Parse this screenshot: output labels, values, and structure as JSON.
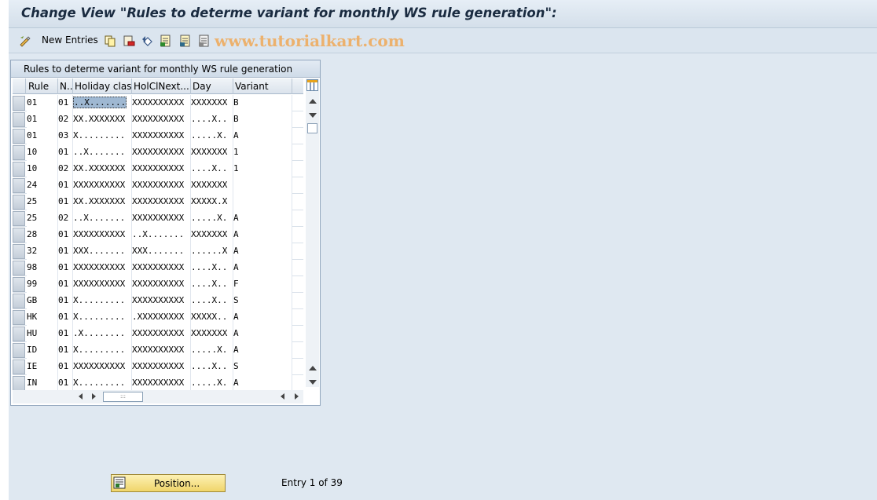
{
  "window": {
    "title": "Change View \"Rules to determe variant for monthly WS rule generation\":"
  },
  "toolbar": {
    "new_entries_label": "New Entries",
    "icons": [
      "display-change-icon",
      "copy-icon",
      "delete-icon",
      "undo-icon",
      "select-all-icon",
      "select-block-icon",
      "deselect-all-icon"
    ]
  },
  "watermark": "www.tutorialkart.com",
  "table": {
    "title": "Rules to determe variant for monthly WS rule generation",
    "columns": [
      "Rule",
      "N..",
      "Holiday class",
      "HolClNext...",
      "Day",
      "Variant"
    ],
    "rows": [
      [
        "01",
        "01",
        "..X.......",
        "XXXXXXXXXX",
        "XXXXXXX",
        "B"
      ],
      [
        "01",
        "02",
        "XX.XXXXXXX",
        "XXXXXXXXXX",
        "....X..",
        "B"
      ],
      [
        "01",
        "03",
        "X.........",
        "XXXXXXXXXX",
        ".....X.",
        "A"
      ],
      [
        "10",
        "01",
        "..X.......",
        "XXXXXXXXXX",
        "XXXXXXX",
        "1"
      ],
      [
        "10",
        "02",
        "XX.XXXXXXX",
        "XXXXXXXXXX",
        "....X..",
        "1"
      ],
      [
        "24",
        "01",
        "XXXXXXXXXX",
        "XXXXXXXXXX",
        "XXXXXXX",
        ""
      ],
      [
        "25",
        "01",
        "XX.XXXXXXX",
        "XXXXXXXXXX",
        "XXXXX.X",
        ""
      ],
      [
        "25",
        "02",
        "..X.......",
        "XXXXXXXXXX",
        ".....X.",
        "A"
      ],
      [
        "28",
        "01",
        "XXXXXXXXXX",
        "..X.......",
        "XXXXXXX",
        "A"
      ],
      [
        "32",
        "01",
        "XXX.......",
        "XXX.......",
        "......X",
        "A"
      ],
      [
        "98",
        "01",
        "XXXXXXXXXX",
        "XXXXXXXXXX",
        "....X..",
        "A"
      ],
      [
        "99",
        "01",
        "XXXXXXXXXX",
        "XXXXXXXXXX",
        "....X..",
        "F"
      ],
      [
        "GB",
        "01",
        "X.........",
        "XXXXXXXXXX",
        "....X..",
        "S"
      ],
      [
        "HK",
        "01",
        "X.........",
        ".XXXXXXXXX",
        "XXXXX..",
        "A"
      ],
      [
        "HU",
        "01",
        ".X........",
        "XXXXXXXXXX",
        "XXXXXXX",
        "A"
      ],
      [
        "ID",
        "01",
        "X.........",
        "XXXXXXXXXX",
        ".....X.",
        "A"
      ],
      [
        "IE",
        "01",
        "XXXXXXXXXX",
        "XXXXXXXXXX",
        "....X..",
        "S"
      ],
      [
        "IN",
        "01",
        "X.........",
        "XXXXXXXXXX",
        ".....X.",
        "A"
      ]
    ]
  },
  "footer": {
    "position_button": "Position...",
    "entry_text": "Entry 1 of 39"
  }
}
